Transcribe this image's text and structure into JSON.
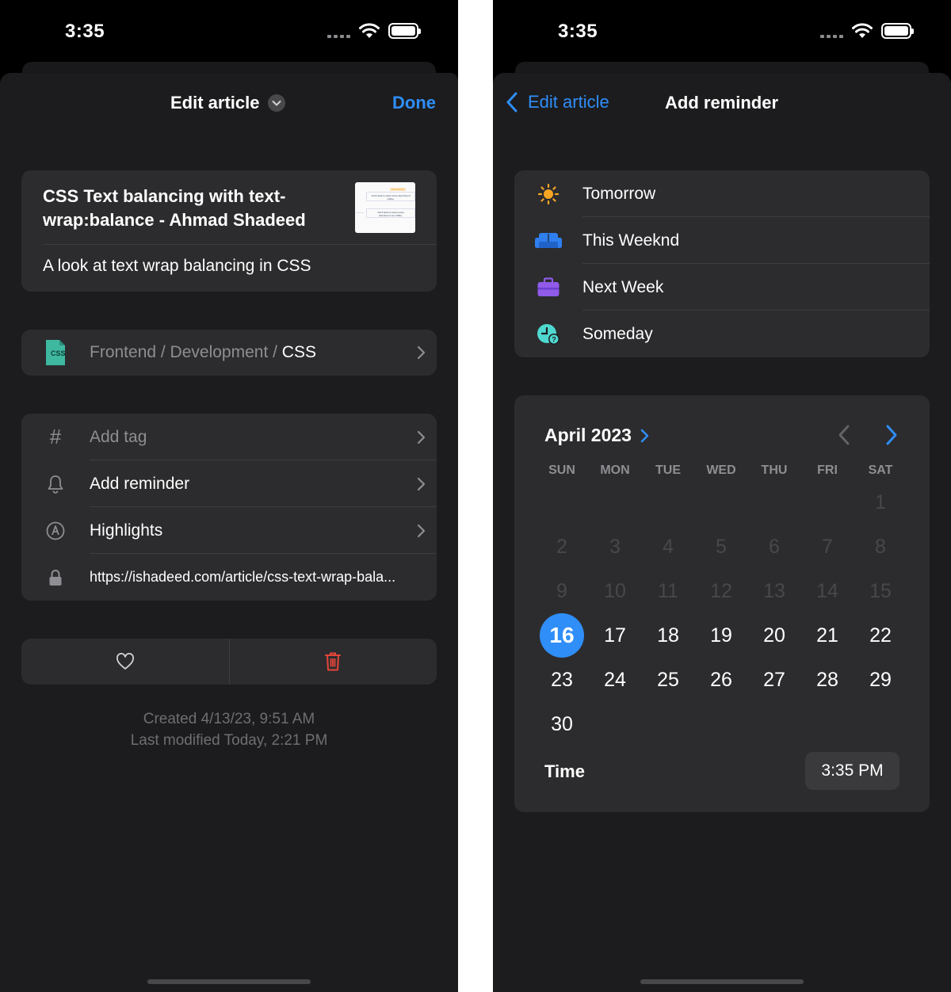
{
  "status_bar": {
    "time": "3:35"
  },
  "left_screen": {
    "nav_title": "Edit article",
    "done_label": "Done",
    "article": {
      "title_line1": "CSS Text balancing with text-",
      "title_line2": "wrap:balance - Ahmad Shadeed",
      "description": "A look at text wrap balancing in CSS",
      "thumb_badge": "BALANCED",
      "thumb_line1": "You'll want to savor every last drop of",
      "thumb_line2": "coffee.",
      "thumb_line3": "You'll want to savor every",
      "thumb_line4": "last drop in our coffee."
    },
    "folder": {
      "icon_label": "CSS",
      "path_prefix": "Frontend / Development / ",
      "path_current": "CSS"
    },
    "details": {
      "tag_placeholder": "Add tag",
      "reminder_label": "Add reminder",
      "highlights_label": "Highlights",
      "url": "https://ishadeed.com/article/css-text-wrap-bala..."
    },
    "meta": {
      "created": "Created 4/13/23, 9:51 AM",
      "modified": "Last modified Today, 2:21 PM"
    }
  },
  "right_screen": {
    "back_label": "Edit article",
    "nav_title": "Add reminder",
    "quick_options": [
      {
        "label": "Tomorrow",
        "icon": "sun-icon"
      },
      {
        "label": "This Weeknd",
        "icon": "sofa-icon"
      },
      {
        "label": "Next Week",
        "icon": "briefcase-icon"
      },
      {
        "label": "Someday",
        "icon": "clock-question-icon"
      }
    ],
    "calendar": {
      "month_label": "April 2023",
      "weekdays": [
        "SUN",
        "MON",
        "TUE",
        "WED",
        "THU",
        "FRI",
        "SAT"
      ],
      "first_weekday_index": 6,
      "days_in_month": 30,
      "selected_day": 16,
      "last_disabled_day": 15,
      "time_label": "Time",
      "time_value": "3:35 PM"
    }
  },
  "colors": {
    "accent": "#2f8ef8",
    "background": "#1c1c1e",
    "card": "#2c2c2e",
    "danger": "#e5453a",
    "css_file": "#3fb8a0",
    "sun": "#f5a623",
    "sofa": "#2f7ff0",
    "briefcase": "#8f5be8",
    "clock": "#4fd8cf"
  }
}
